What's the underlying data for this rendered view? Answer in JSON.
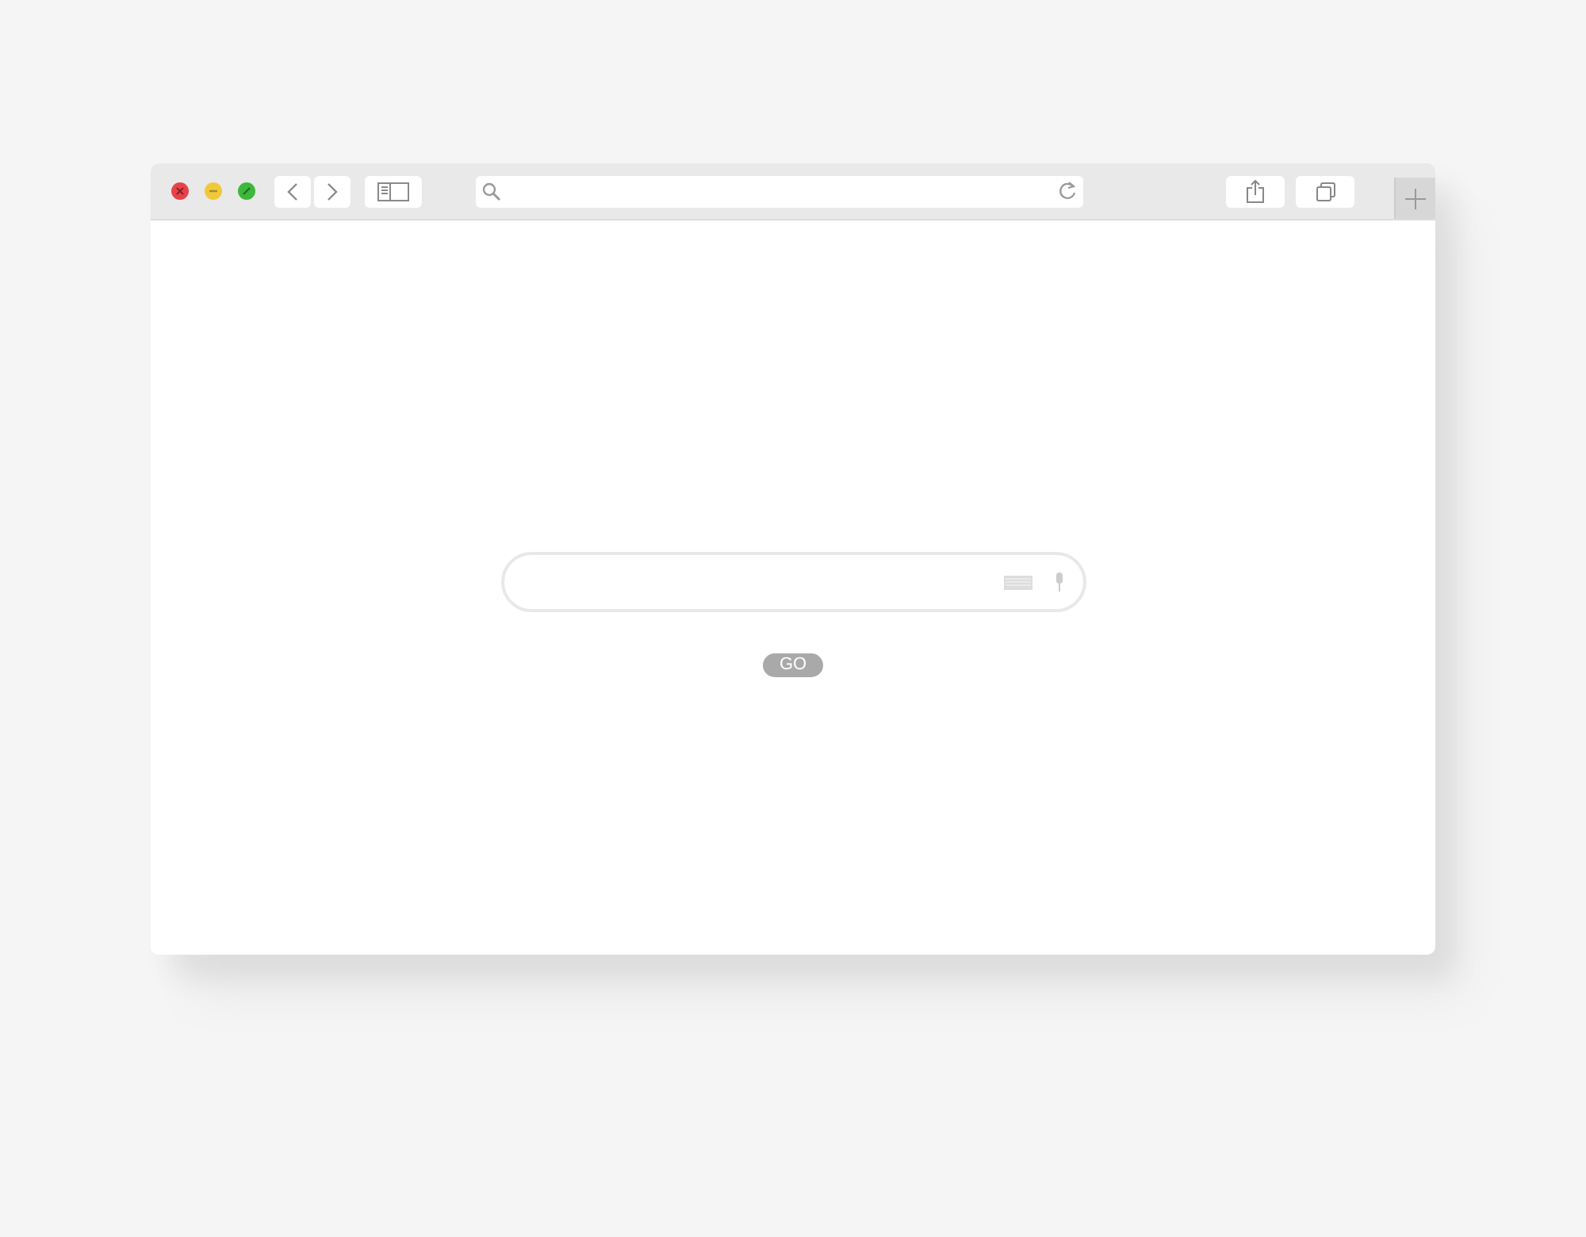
{
  "window": {
    "controls": [
      {
        "kind": "close",
        "color": "#e8414a"
      },
      {
        "kind": "minimize",
        "color": "#f0c93a"
      },
      {
        "kind": "zoom",
        "color": "#3cb83a"
      }
    ]
  },
  "search": {
    "button": "GO"
  }
}
